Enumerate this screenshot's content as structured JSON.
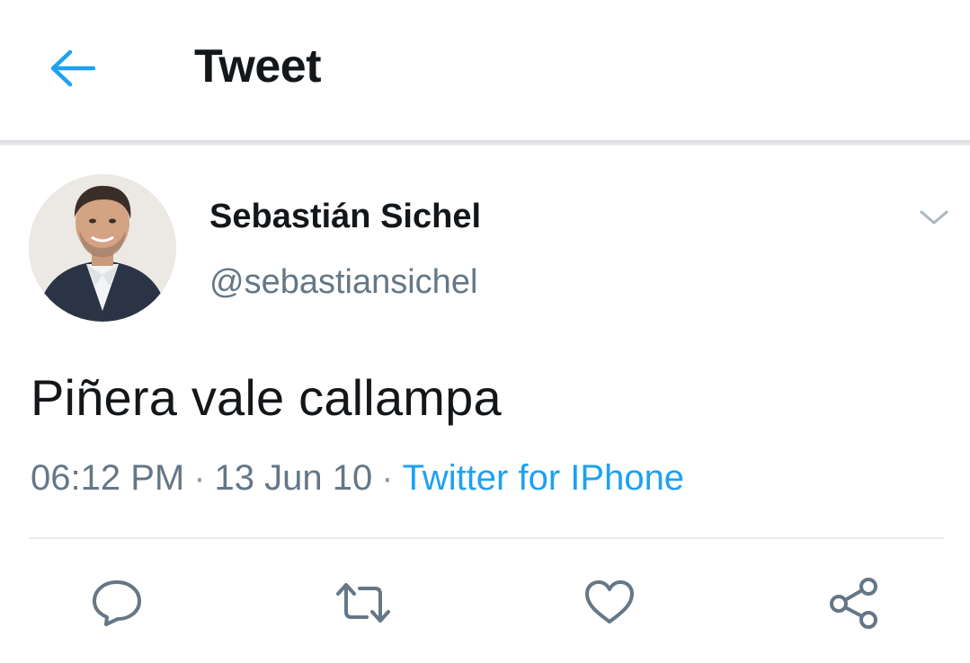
{
  "header": {
    "title": "Tweet",
    "back_icon": "arrow-left-icon",
    "accent_color": "#1da1f2"
  },
  "author": {
    "name": "Sebastián Sichel",
    "handle": "@sebastiansichel",
    "avatar_icon": "profile-photo",
    "menu_icon": "chevron-down-icon"
  },
  "tweet": {
    "text": "Piñera vale callampa",
    "time": "06:12 PM",
    "date": "13 Jun 10",
    "separator": "·",
    "source": "Twitter for IPhone"
  },
  "actions": {
    "reply_icon": "comment-icon",
    "retweet_icon": "retweet-icon",
    "like_icon": "heart-icon",
    "share_icon": "share-icon",
    "icon_color": "#657786"
  }
}
